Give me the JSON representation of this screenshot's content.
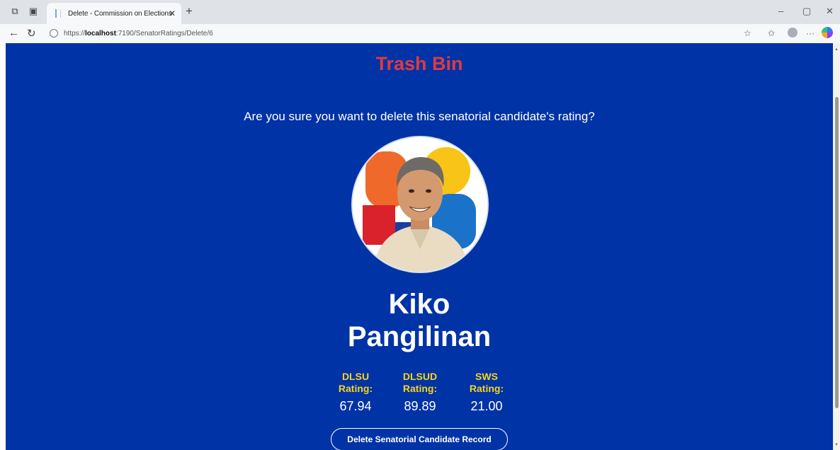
{
  "browser": {
    "tab_title": "Delete - Commission on Elections",
    "url_prefix": "https://",
    "url_host": "localhost",
    "url_rest": ":7190/SenatorRatings/Delete/6"
  },
  "icons": {
    "tab_actions": "tab-actions-icon",
    "vertical_tabs": "vertical-tabs-icon",
    "back": "back-arrow-icon",
    "refresh": "refresh-icon",
    "lock": "lock-icon",
    "favorite": "star-icon",
    "favorites": "favorites-icon",
    "profile": "profile-icon",
    "more": "more-icon",
    "copilot": "copilot-icon"
  },
  "page": {
    "heading": "Trash Bin",
    "question": "Are you sure you want to delete this senatorial candidate's rating?",
    "candidate": {
      "first_name": "Kiko",
      "last_name": "Pangilinan"
    },
    "ratings": [
      {
        "label": "DLSU Rating:",
        "value": "67.94"
      },
      {
        "label": "DLSUD Rating:",
        "value": "89.89"
      },
      {
        "label": "SWS Rating:",
        "value": "21.00"
      }
    ],
    "delete_button": "Delete Senatorial Candidate Record"
  },
  "colors": {
    "page_bg": "#0033a6",
    "heading": "#e03a3e",
    "rating_label": "#f5d41f",
    "text": "#ffffff"
  }
}
